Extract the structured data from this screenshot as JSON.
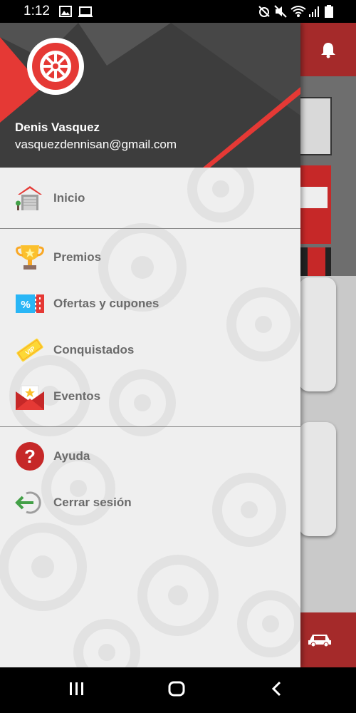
{
  "status_bar": {
    "time": "1:12",
    "icons": [
      "image-icon",
      "cast-icon",
      "alarm-icon",
      "mute-icon",
      "wifi-icon",
      "signal-icon",
      "battery-icon"
    ]
  },
  "drawer": {
    "user": {
      "name": "Denis Vasquez",
      "email": "vasquezdennisan@gmail.com"
    },
    "menu": [
      {
        "label": "Inicio",
        "icon": "garage-icon"
      },
      {
        "label": "Premios",
        "icon": "trophy-icon"
      },
      {
        "label": "Ofertas y cupones",
        "icon": "coupon-icon"
      },
      {
        "label": "Conquistados",
        "icon": "vip-ticket-icon"
      },
      {
        "label": "Eventos",
        "icon": "invitation-icon"
      },
      {
        "label": "Ayuda",
        "icon": "help-icon"
      },
      {
        "label": "Cerrar sesión",
        "icon": "logout-icon"
      }
    ]
  },
  "colors": {
    "accent": "#e53935",
    "header_dark": "#474747",
    "app_red": "#a52a2a",
    "menu_text": "#6b6b6b"
  },
  "background_app": {
    "icons": [
      "bell-icon",
      "car-icon"
    ]
  },
  "nav_bar": {
    "icons": [
      "recents-icon",
      "home-icon",
      "back-icon"
    ]
  }
}
